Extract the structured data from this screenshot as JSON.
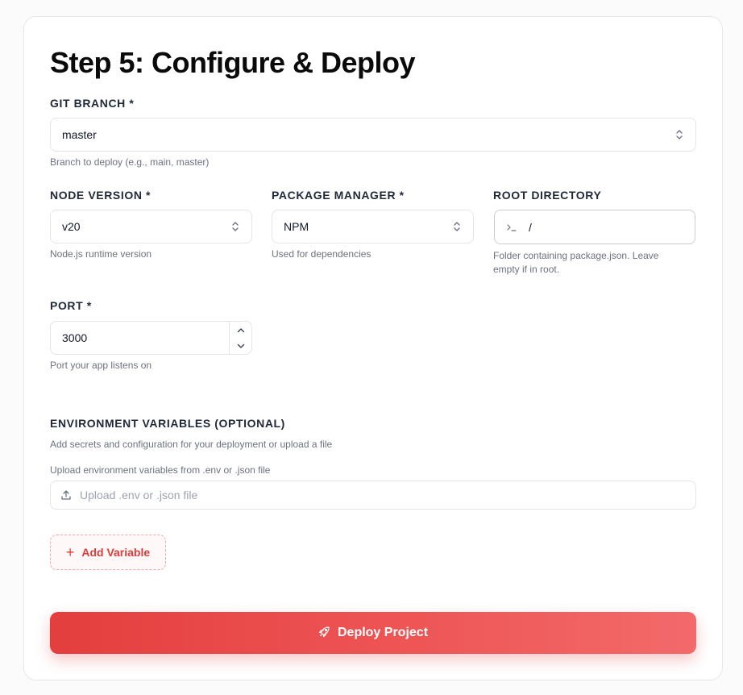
{
  "title": "Step 5: Configure & Deploy",
  "git_branch": {
    "label": "GIT BRANCH *",
    "value": "master",
    "help": "Branch to deploy (e.g., main, master)"
  },
  "node_version": {
    "label": "NODE VERSION *",
    "value": "v20",
    "help": "Node.js runtime version"
  },
  "package_manager": {
    "label": "PACKAGE MANAGER *",
    "value": "NPM",
    "help": "Used for dependencies"
  },
  "root_directory": {
    "label": "ROOT DIRECTORY",
    "value": "/",
    "help": "Folder containing package.json. Leave empty if in root."
  },
  "port": {
    "label": "PORT *",
    "value": "3000",
    "help": "Port your app listens on"
  },
  "env_vars": {
    "label": "ENVIRONMENT VARIABLES (OPTIONAL)",
    "description": "Add secrets and configuration for your deployment or upload a file",
    "upload_label": "Upload environment variables from .env or .json file",
    "upload_placeholder": "Upload .env or .json file",
    "add_button": "Add Variable"
  },
  "deploy_button": "Deploy Project",
  "colors": {
    "accent": "#e53e3e",
    "accent_light": "#f36a6a"
  },
  "icons": {
    "select": "chevron-up-down-icon",
    "terminal": "terminal-prompt-icon",
    "upload": "upload-icon",
    "add": "plus-icon",
    "deploy": "rocket-icon"
  }
}
